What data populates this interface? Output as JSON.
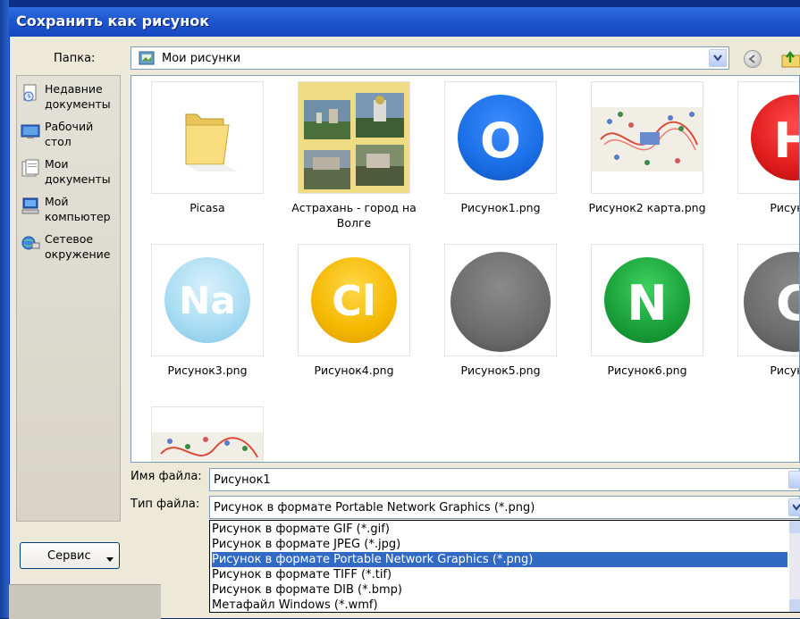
{
  "window": {
    "title": "Сохранить как рисунок"
  },
  "toolbar": {
    "folder_label": "Папка:",
    "folder_value": "Мои рисунки",
    "back_icon": "back-arrow-icon",
    "up_icon": "folder-up-icon"
  },
  "places": [
    {
      "label": "Недавние документы",
      "icon": "recent-documents-icon"
    },
    {
      "label": "Рабочий стол",
      "icon": "desktop-icon"
    },
    {
      "label": "Мои документы",
      "icon": "my-documents-icon"
    },
    {
      "label": "Мой компьютер",
      "icon": "my-computer-icon"
    },
    {
      "label": "Сетевое окружение",
      "icon": "network-places-icon"
    }
  ],
  "files": [
    {
      "name": "Picasa",
      "kind": "folder"
    },
    {
      "name": "Астрахань - город на Волге",
      "kind": "photo-folder"
    },
    {
      "name": "Рисунок1.png",
      "kind": "circle",
      "letter": "O",
      "color": "#1a6fe6"
    },
    {
      "name": "Рисунок2 карта.png",
      "kind": "map"
    },
    {
      "name": "Рисунок",
      "kind": "circle",
      "letter": "H",
      "color": "#e11d1d"
    },
    {
      "name": "Рисунок3.png",
      "kind": "circle",
      "letter": "Na",
      "color": "#a8dcf2"
    },
    {
      "name": "Рисунок4.png",
      "kind": "circle",
      "letter": "Cl",
      "color": "#f5b800"
    },
    {
      "name": "Рисунок5.png",
      "kind": "circle",
      "letter": "",
      "color": "#6d6d6d"
    },
    {
      "name": "Рисунок6.png",
      "kind": "circle",
      "letter": "N",
      "color": "#1aa03a"
    },
    {
      "name": "Рисунок",
      "kind": "circle",
      "letter": "C",
      "color": "#6d6d6d"
    },
    {
      "name": "",
      "kind": "map"
    }
  ],
  "form": {
    "filename_label": "Имя файла:",
    "filename_value": "Рисунок1",
    "filetype_label": "Тип файла:",
    "filetype_value": "Рисунок в формате Portable Network Graphics (*.png)"
  },
  "filetype_options": [
    "Рисунок в формате GIF (*.gif)",
    "Рисунок в формате JPEG (*.jpg)",
    "Рисунок в формате Portable Network Graphics (*.png)",
    "Рисунок в формате TIFF (*.tif)",
    "Рисунок в формате DIB (*.bmp)",
    "Метафайл Windows (*.wmf)"
  ],
  "filetype_selected_index": 2,
  "buttons": {
    "service_label": "Сервис"
  },
  "colors": {
    "title_bar": "#1f56cf",
    "selection": "#316ac5",
    "dialog_bg": "#ece9d8"
  }
}
